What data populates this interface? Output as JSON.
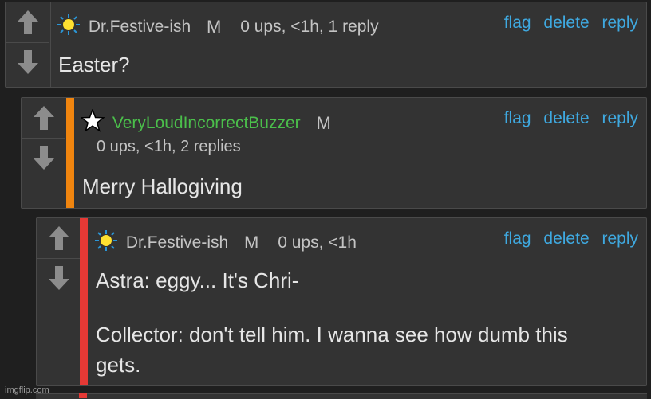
{
  "comments": [
    {
      "username": "Dr.Festive-ish",
      "mod_label": "M",
      "stats": "0 ups, <1h, 1 reply",
      "body": "Easter?",
      "badge_icon": "sun-icon",
      "accent_color": null
    },
    {
      "username": "VeryLoudIncorrectBuzzer",
      "mod_label": "M",
      "stats": "0 ups, <1h, 2 replies",
      "body": "Merry Hallogiving",
      "badge_icon": "star-icon",
      "accent_color": "#f0850f"
    },
    {
      "username": "Dr.Festive-ish",
      "mod_label": "M",
      "stats": "0 ups, <1h",
      "body_lines": [
        "Astra: eggy... It's Chri-",
        "Collector: don't tell him. I wanna see how dumb this",
        "gets."
      ],
      "badge_icon": "sun-icon",
      "accent_color": "#e53935"
    }
  ],
  "actions": {
    "flag": "flag",
    "delete": "delete",
    "reply": "reply"
  },
  "colors": {
    "link": "#3fa9e0",
    "username_green": "#4bbf4b"
  },
  "watermark": "imgflip.com"
}
